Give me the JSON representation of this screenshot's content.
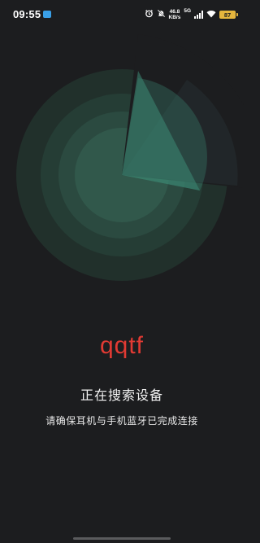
{
  "status_bar": {
    "time": "09:55",
    "net_speed_value": "46.8",
    "net_speed_unit": "KB/s",
    "network_type": "5G",
    "battery_level": "87",
    "icons": [
      "app-notification-icon",
      "alarm-icon",
      "mute-icon",
      "signal-icon",
      "wifi-icon",
      "battery-icon"
    ]
  },
  "radar": {
    "state": "scanning",
    "accent_color": "#3e8c76"
  },
  "main": {
    "device_name": "qqtf",
    "status_title": "正在搜索设备",
    "hint": "请确保耳机与手机蓝牙已完成连接"
  },
  "colors": {
    "background": "#1c1d1f",
    "device_name": "#e13a33",
    "battery": "#e6b63d"
  }
}
